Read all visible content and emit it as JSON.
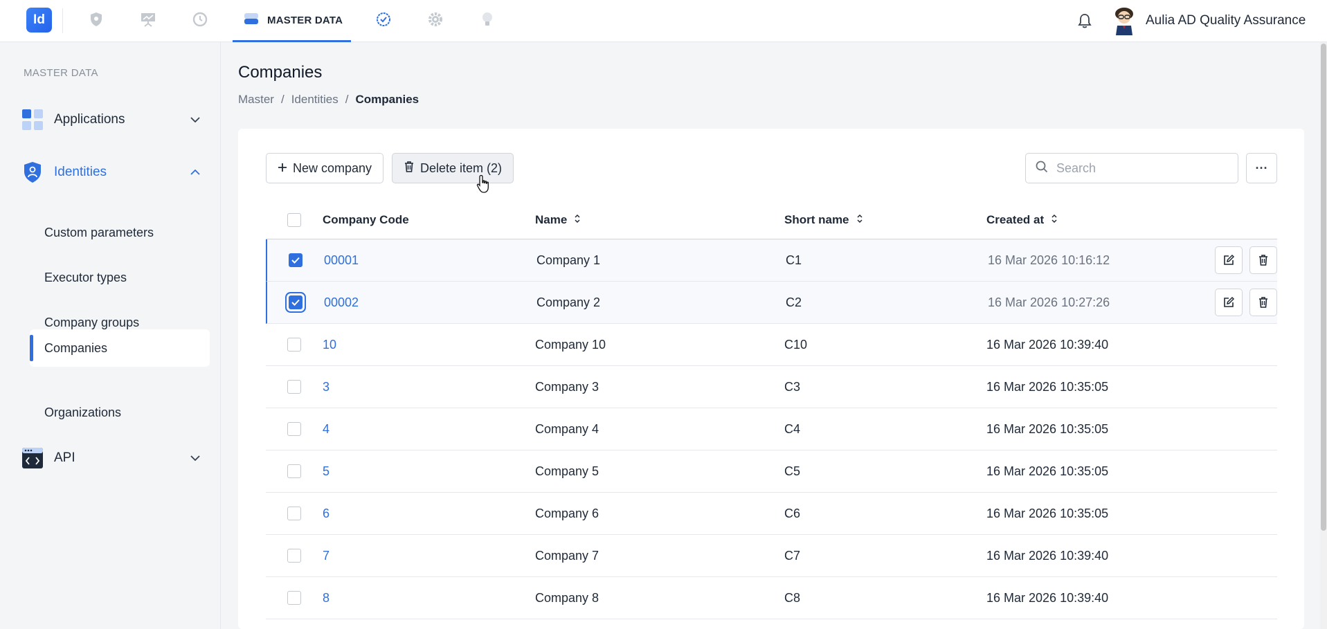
{
  "header": {
    "logo_text": "Id",
    "active_tab_label": "MASTER DATA",
    "user_name": "Aulia AD Quality Assurance",
    "nav_icons": [
      "shield-icon",
      "presentation-icon",
      "history-icon",
      "database-icon",
      "badge-check-icon",
      "gear-icon",
      "lightbulb-icon"
    ],
    "accent_color": "#2f6fde"
  },
  "sidebar": {
    "heading": "MASTER DATA",
    "groups": [
      {
        "label": "Applications",
        "icon": "apps-grid-icon",
        "expanded": false
      },
      {
        "label": "Identities",
        "icon": "identity-shield-icon",
        "expanded": true
      },
      {
        "label": "API",
        "icon": "code-window-icon",
        "expanded": false
      }
    ],
    "identity_items": [
      {
        "label": "Custom parameters"
      },
      {
        "label": "Executor types"
      },
      {
        "label": "Company groups"
      },
      {
        "label": "Companies",
        "active": true
      },
      {
        "label": "Organizations"
      }
    ]
  },
  "page": {
    "title": "Companies",
    "breadcrumb": [
      "Master",
      "Identities",
      "Companies"
    ]
  },
  "toolbar": {
    "new_label": "New company",
    "delete_label": "Delete item (2)",
    "search_placeholder": "Search",
    "more_label": "···"
  },
  "table": {
    "columns": [
      "Company Code",
      "Name",
      "Short name",
      "Created at"
    ],
    "sortable": [
      false,
      true,
      true,
      true
    ],
    "rows": [
      {
        "code": "00001",
        "name": "Company 1",
        "short": "C1",
        "created": "16 Mar 2026 10:16:12",
        "selected": true
      },
      {
        "code": "00002",
        "name": "Company 2",
        "short": "C2",
        "created": "16 Mar 2026 10:27:26",
        "selected": true
      },
      {
        "code": "10",
        "name": "Company 10",
        "short": "C10",
        "created": "16 Mar 2026 10:39:40",
        "selected": false
      },
      {
        "code": "3",
        "name": "Company 3",
        "short": "C3",
        "created": "16 Mar 2026 10:35:05",
        "selected": false
      },
      {
        "code": "4",
        "name": "Company 4",
        "short": "C4",
        "created": "16 Mar 2026 10:35:05",
        "selected": false
      },
      {
        "code": "5",
        "name": "Company 5",
        "short": "C5",
        "created": "16 Mar 2026 10:35:05",
        "selected": false
      },
      {
        "code": "6",
        "name": "Company 6",
        "short": "C6",
        "created": "16 Mar 2026 10:35:05",
        "selected": false
      },
      {
        "code": "7",
        "name": "Company 7",
        "short": "C7",
        "created": "16 Mar 2026 10:39:40",
        "selected": false
      },
      {
        "code": "8",
        "name": "Company 8",
        "short": "C8",
        "created": "16 Mar 2026 10:39:40",
        "selected": false
      }
    ]
  }
}
